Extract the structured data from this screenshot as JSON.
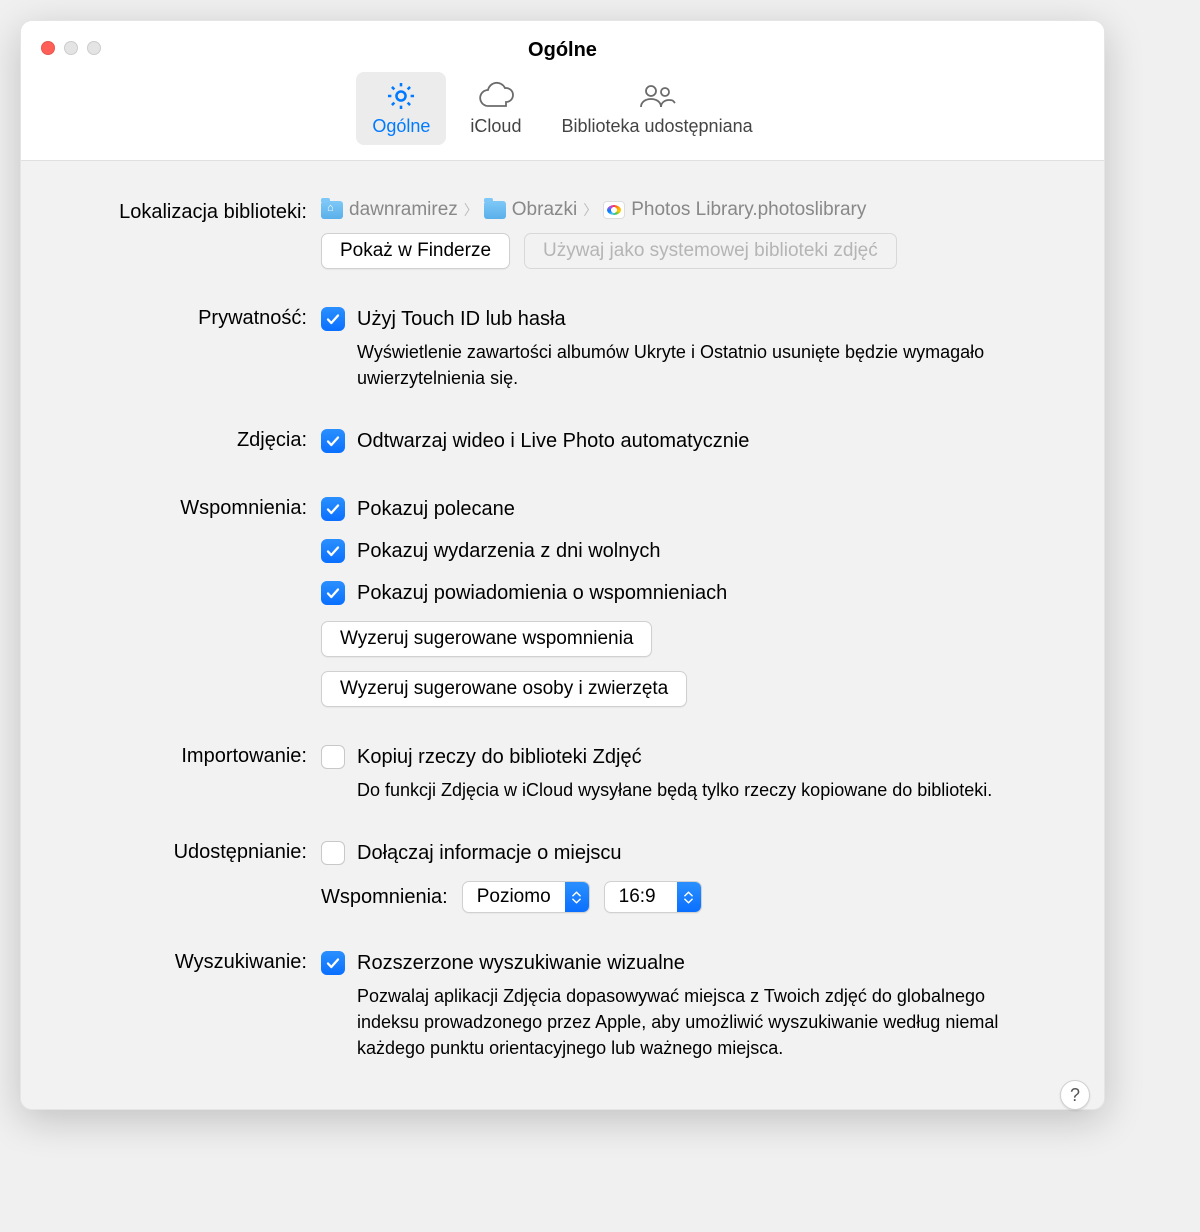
{
  "window": {
    "title": "Ogólne"
  },
  "tabs": {
    "general": "Ogólne",
    "icloud": "iCloud",
    "shared": "Biblioteka udostępniana"
  },
  "labels": {
    "library_location": "Lokalizacja biblioteki:",
    "privacy": "Prywatność:",
    "photos": "Zdjęcia:",
    "memories": "Wspomnienia:",
    "importing": "Importowanie:",
    "sharing": "Udostępnianie:",
    "search": "Wyszukiwanie:",
    "memories_sub": "Wspomnienia:"
  },
  "breadcrumb": {
    "p0": "dawnramirez",
    "p1": "Obrazki",
    "p2": "Photos Library.photoslibrary"
  },
  "buttons": {
    "show_in_finder": "Pokaż w Finderze",
    "use_as_system": "Używaj jako systemowej biblioteki zdjęć",
    "reset_memories": "Wyzeruj sugerowane wspomnienia",
    "reset_people": "Wyzeruj sugerowane osoby i zwierzęta"
  },
  "checks": {
    "touchid": "Użyj Touch ID lub hasła",
    "touchid_desc": "Wyświetlenie zawartości albumów Ukryte i Ostatnio usunięte będzie wymagało uwierzytelnienia się.",
    "autoplay": "Odtwarzaj wideo i Live Photo automatycznie",
    "show_featured": "Pokazuj polecane",
    "show_holidays": "Pokazuj wydarzenia z dni wolnych",
    "show_notifications": "Pokazuj powiadomienia o wspomnieniach",
    "copy_import": "Kopiuj rzeczy do biblioteki Zdjęć",
    "copy_import_desc": "Do funkcji Zdjęcia w iCloud wysyłane będą tylko rzeczy kopiowane do biblioteki.",
    "include_location": "Dołączaj informacje o miejscu",
    "enhanced_search": "Rozszerzone wyszukiwanie wizualne",
    "enhanced_search_desc": "Pozwalaj aplikacji Zdjęcia dopasowywać miejsca z Twoich zdjęć do globalnego indeksu prowadzonego przez Apple, aby umożliwić wyszukiwanie według niemal każdego punktu orientacyjnego lub ważnego miejsca."
  },
  "selects": {
    "orientation": "Poziomo",
    "ratio": "16:9"
  },
  "help": "?"
}
